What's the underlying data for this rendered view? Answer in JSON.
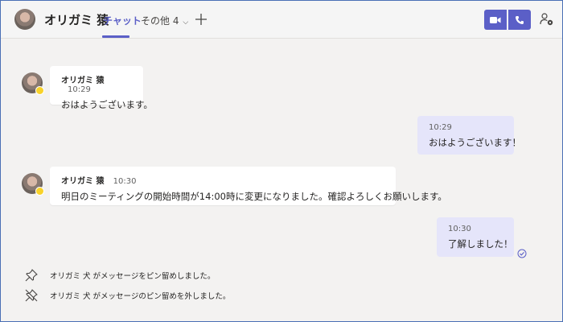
{
  "header": {
    "contact_name": "オリガミ 猿",
    "tabs": [
      {
        "label": "チャット"
      },
      {
        "label": "その他 4"
      }
    ]
  },
  "messages": [
    {
      "direction": "incoming",
      "sender": "オリガミ 猿",
      "time": "10:29",
      "text": "おはようございます。"
    },
    {
      "direction": "outgoing",
      "time": "10:29",
      "text": "おはようございます！"
    },
    {
      "direction": "incoming",
      "sender": "オリガミ 猿",
      "time": "10:30",
      "text": "明日のミーティングの開始時間が14:00時に変更になりました。確認よろしくお願いします。"
    },
    {
      "direction": "outgoing",
      "time": "10:30",
      "text": "了解しました！"
    }
  ],
  "system_events": [
    {
      "icon": "pin-icon",
      "text": "オリガミ 犬 がメッセージをピン留めしました。"
    },
    {
      "icon": "unpin-icon",
      "text": "オリガミ 犬 がメッセージのピン留めを外しました。"
    }
  ],
  "colors": {
    "accent": "#5b5fc7",
    "outgoing_bubble": "#e5e5fa",
    "incoming_bubble": "#ffffff",
    "background": "#f3f2f1",
    "status_away": "#f8d22a"
  }
}
